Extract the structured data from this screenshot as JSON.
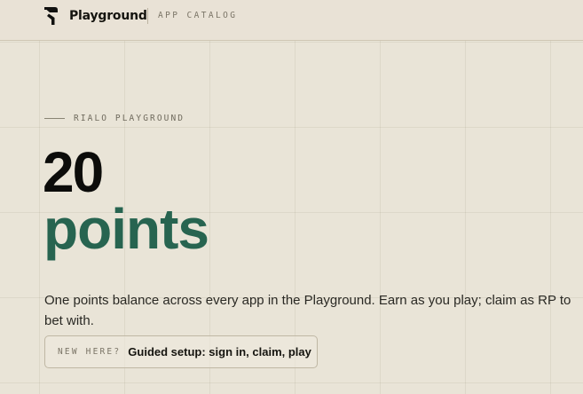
{
  "header": {
    "brand_name": "Playground",
    "logo_icon": "playground-logo-icon",
    "section_label": "APP CATALOG"
  },
  "hero": {
    "eyebrow": "RIALO PLAYGROUND",
    "points_value": "20",
    "points_unit": "points",
    "description": "One points balance across every app in the Playground. Earn as you play; claim as RP to bet with."
  },
  "cta": {
    "eyebrow": "NEW HERE?",
    "label": "Guided setup: sign in, claim, play"
  },
  "colors": {
    "background": "#e9e4d7",
    "accent_green": "#276450",
    "text_dark": "#0c0c0a",
    "muted": "#7b7567"
  }
}
